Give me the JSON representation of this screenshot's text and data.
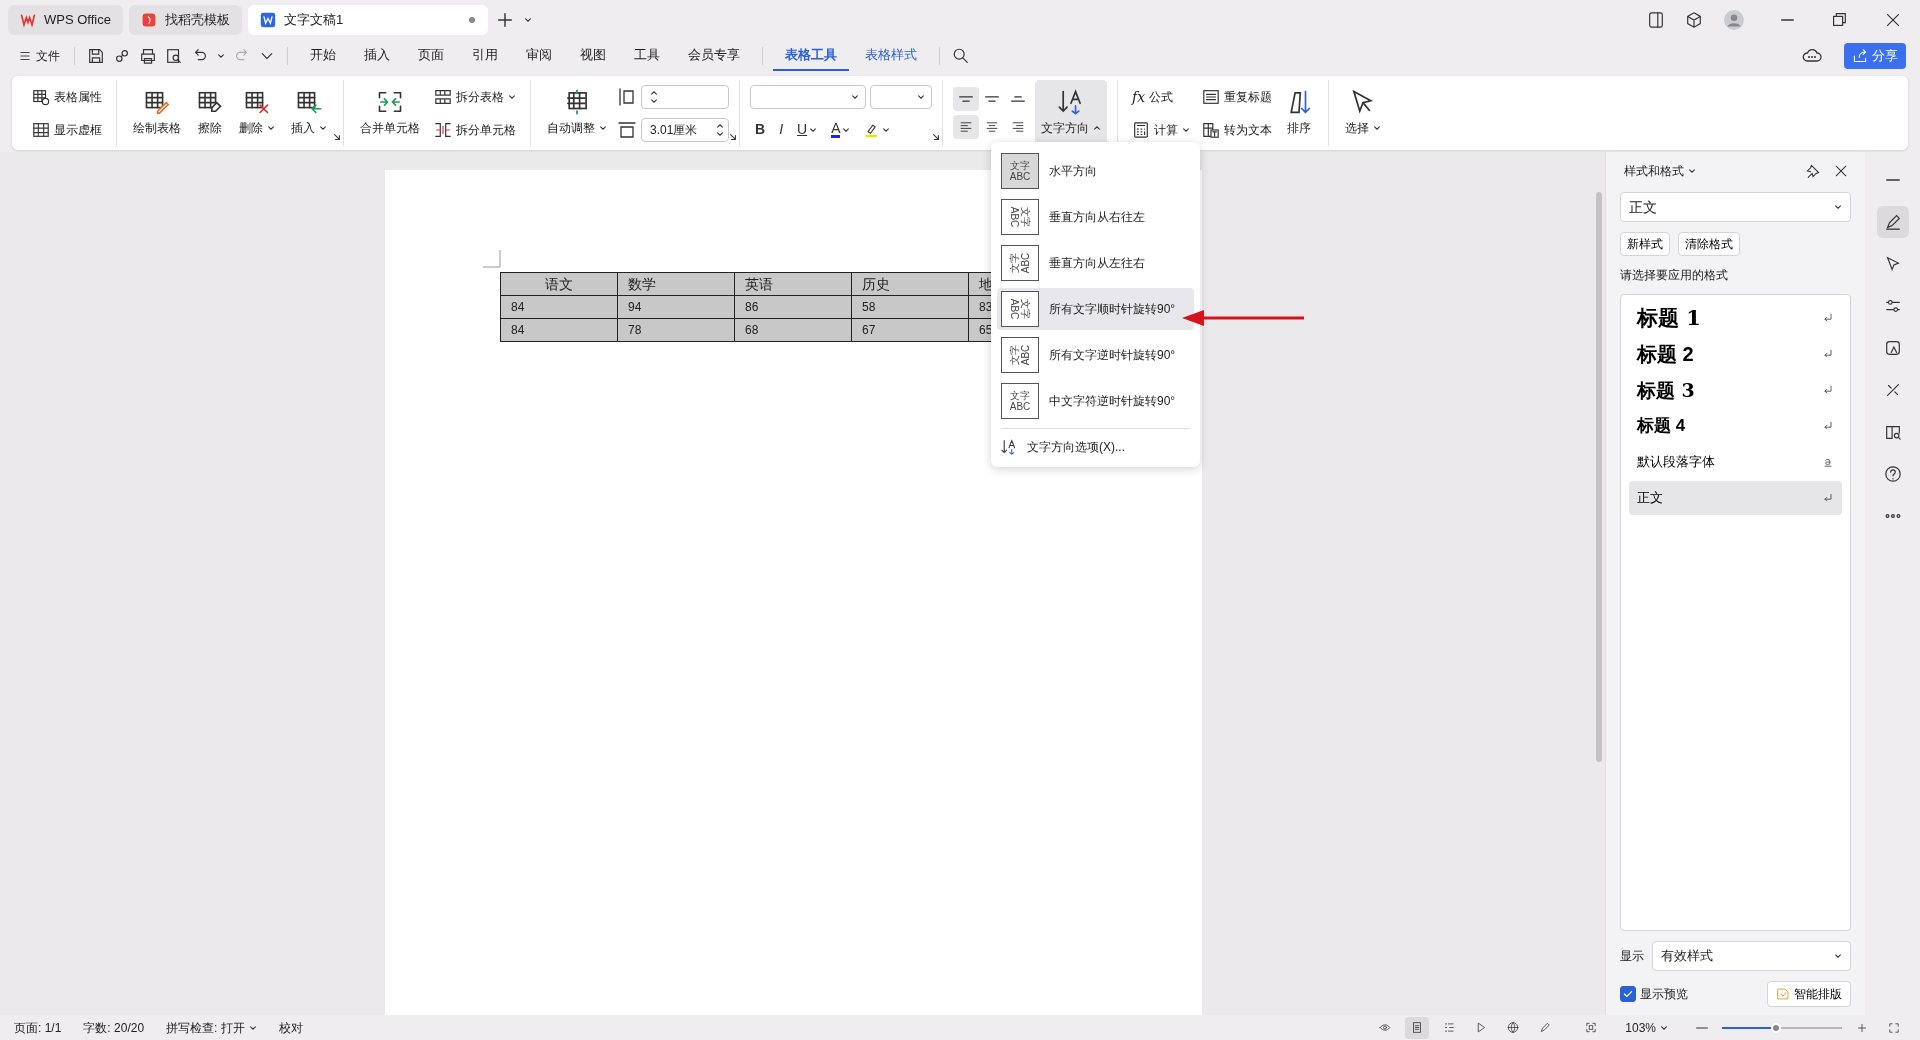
{
  "tabs": [
    {
      "label": "WPS Office",
      "selected": false,
      "kind": "wps"
    },
    {
      "label": "找稻壳模板",
      "selected": false,
      "kind": "docer"
    },
    {
      "label": "文字文稿1",
      "selected": true,
      "kind": "doc"
    }
  ],
  "menu": {
    "file": "文件",
    "tabs": [
      {
        "label": "开始",
        "selected": false,
        "contextual": false
      },
      {
        "label": "插入",
        "selected": false,
        "contextual": false
      },
      {
        "label": "页面",
        "selected": false,
        "contextual": false
      },
      {
        "label": "引用",
        "selected": false,
        "contextual": false
      },
      {
        "label": "审阅",
        "selected": false,
        "contextual": false
      },
      {
        "label": "视图",
        "selected": false,
        "contextual": false
      },
      {
        "label": "工具",
        "selected": false,
        "contextual": false
      },
      {
        "label": "会员专享",
        "selected": false,
        "contextual": false
      },
      {
        "label": "表格工具",
        "selected": true,
        "contextual": true
      },
      {
        "label": "表格样式",
        "selected": false,
        "contextual": true
      }
    ],
    "share": "分享"
  },
  "ribbon": [
    {
      "launcher": false,
      "cells": [
        {
          "kind": "stack",
          "items": [
            {
              "label": "表格属性",
              "dropdown": false
            },
            {
              "label": "显示虚框",
              "dropdown": false
            }
          ]
        }
      ]
    },
    {
      "launcher": true,
      "cells": [
        {
          "kind": "large",
          "label": "绘制表格",
          "dropdown": false,
          "active": false
        },
        {
          "kind": "large",
          "label": "擦除",
          "dropdown": false,
          "active": false
        },
        {
          "kind": "large",
          "label": "删除",
          "dropdown": true,
          "active": false
        },
        {
          "kind": "large",
          "label": "插入",
          "dropdown": true,
          "active": false
        }
      ]
    },
    {
      "launcher": false,
      "cells": [
        {
          "kind": "large",
          "label": "合并单元格",
          "dropdown": false,
          "active": false
        },
        {
          "kind": "stack",
          "items": [
            {
              "label": "拆分表格",
              "dropdown": true
            },
            {
              "label": "拆分单元格",
              "dropdown": false
            }
          ]
        }
      ]
    },
    {
      "launcher": true,
      "cells": [
        {
          "kind": "large",
          "label": "自动调整",
          "dropdown": true,
          "active": false
        },
        {
          "kind": "fields",
          "items": [
            {
              "kind": "spin"
            },
            {
              "kind": "spin",
              "value": "3.01厘米"
            }
          ]
        }
      ]
    },
    {
      "launcher": true,
      "cells": [
        {
          "kind": "format",
          "items": [
            {
              "glyph": "B",
              "dropdown": false
            },
            {
              "glyph": "I",
              "dropdown": false
            },
            {
              "glyph": "U",
              "dropdown": true
            },
            {
              "glyph": "A",
              "dropdown": true
            },
            {
              "dropdown": true
            }
          ]
        }
      ]
    },
    {
      "launcher": false,
      "cells": [
        {
          "kind": "align",
          "items": [
            {
              "active": true
            },
            {
              "active": false
            },
            {
              "active": false
            },
            {
              "active": true
            },
            {
              "active": false
            },
            {
              "active": false
            }
          ]
        },
        {
          "kind": "large",
          "label": "文字方向",
          "dropdown": true,
          "active": true,
          "expanded": true
        }
      ]
    },
    {
      "launcher": false,
      "cells": [
        {
          "kind": "stack",
          "items": [
            {
              "label": "公式",
              "glyph": "fx",
              "dropdown": false
            },
            {
              "label": "计算",
              "dropdown": true
            }
          ]
        },
        {
          "kind": "stack",
          "items": [
            {
              "label": "重复标题",
              "dropdown": false
            },
            {
              "label": "转为文本",
              "dropdown": false
            }
          ]
        },
        {
          "kind": "large",
          "label": "排序",
          "dropdown": false,
          "active": false
        }
      ]
    },
    {
      "launcher": false,
      "cells": [
        {
          "kind": "large",
          "label": "选择",
          "dropdown": true,
          "active": false
        }
      ]
    }
  ],
  "document": {
    "table": {
      "columns": [
        "语文",
        "数学",
        "英语",
        "历史",
        "地"
      ],
      "rows": [
        [
          "84",
          "94",
          "86",
          "58",
          "83"
        ],
        [
          "84",
          "78",
          "68",
          "67",
          "65"
        ]
      ]
    }
  },
  "text_direction_menu": {
    "items": [
      {
        "label": "水平方向",
        "kind": "horizontal",
        "icon_lines": [
          "文字",
          "ABC"
        ],
        "selected": true,
        "hovered": false
      },
      {
        "label": "垂直方向从右往左",
        "kind": "vertical-rl",
        "icon_lines": [
          "文字",
          "ABC"
        ],
        "selected": false,
        "hovered": false
      },
      {
        "label": "垂直方向从左往右",
        "kind": "vertical-lr",
        "icon_lines": [
          "文字",
          "ABC"
        ],
        "selected": false,
        "hovered": false
      },
      {
        "label": "所有文字顺时针旋转90°",
        "kind": "rotate-cw",
        "icon_lines": [
          "文字",
          "ABC"
        ],
        "selected": false,
        "hovered": true
      },
      {
        "label": "所有文字逆时针旋转90°",
        "kind": "rotate-ccw",
        "icon_lines": [
          "文字",
          "ABC"
        ],
        "selected": false,
        "hovered": false
      },
      {
        "label": "中文字符逆时针旋转90°",
        "kind": "cjk-ccw",
        "icon_lines": [
          "文字",
          "ABC"
        ],
        "selected": false,
        "hovered": false
      }
    ],
    "footer": "文字方向选项(X)..."
  },
  "styles_panel": {
    "title": "样式和格式",
    "current": "正文",
    "buttons": [
      "新样式",
      "清除格式"
    ],
    "prompt": "请选择要应用的格式",
    "styles": [
      {
        "label": "标题 1",
        "kind": "heading1",
        "character": false,
        "selected": false
      },
      {
        "label": "标题 2",
        "kind": "heading2",
        "character": false,
        "selected": false
      },
      {
        "label": "标题 3",
        "kind": "heading3",
        "character": false,
        "selected": false
      },
      {
        "label": "标题 4",
        "kind": "heading4",
        "character": false,
        "selected": false
      },
      {
        "label": "默认段落字体",
        "kind": "plain",
        "character": true,
        "selected": false
      },
      {
        "label": "正文",
        "kind": "plain",
        "character": false,
        "selected": true
      }
    ],
    "show_label": "显示",
    "show_value": "有效样式",
    "preview": {
      "label": "显示预览",
      "checked": true
    },
    "smart_button": "智能排版"
  },
  "side_tools": [
    {
      "selected": true
    },
    {
      "selected": false
    },
    {
      "selected": false
    },
    {
      "selected": false
    },
    {
      "selected": false
    },
    {
      "selected": false
    },
    {
      "selected": false
    },
    {
      "selected": false
    }
  ],
  "status_bar": {
    "page": "页面: 1/1",
    "words": "字数: 20/20",
    "spell": "拼写检查: 打开",
    "proof": "校对",
    "views": [
      {
        "selected": false
      },
      {
        "selected": true
      },
      {
        "selected": false
      },
      {
        "selected": false
      },
      {
        "selected": false
      },
      {
        "selected": false
      }
    ],
    "zoom": "103%",
    "zoom_slider": {
      "level": 0.45
    }
  }
}
